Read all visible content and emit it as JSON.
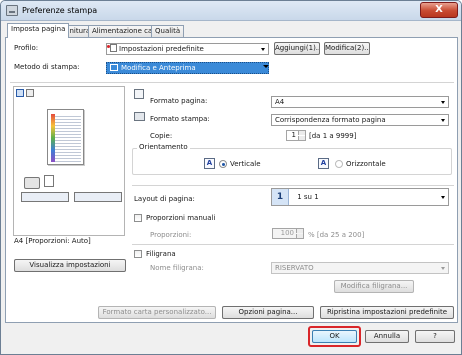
{
  "window": {
    "title": "Preferenze stampa",
    "close_label": "X"
  },
  "tabs": [
    {
      "label": "Imposta pagina",
      "active": true
    },
    {
      "label": "Finitura",
      "active": false
    },
    {
      "label": "Alimentazione carta",
      "active": false
    },
    {
      "label": "Qualità",
      "active": false
    }
  ],
  "profile": {
    "label": "Profilo:",
    "value": "Impostazioni predefinite",
    "add_label": "Aggiungi(1)...",
    "edit_label": "Modifica(2)..."
  },
  "print_method": {
    "label": "Metodo di stampa:",
    "value": "Modifica e Anteprima"
  },
  "preview": {
    "caption": "A4 [Proporzioni: Auto]",
    "show_settings_label": "Visualizza impostazioni"
  },
  "page_size": {
    "label": "Formato pagina:",
    "value": "A4"
  },
  "output_size": {
    "label": "Formato stampa:",
    "value": "Corrispondenza formato pagina"
  },
  "copies": {
    "label": "Copie:",
    "value": "1",
    "range": "[da 1 a 9999]"
  },
  "orientation": {
    "group_label": "Orientamento",
    "portrait_label": "Verticale",
    "landscape_label": "Orizzontale",
    "portrait_glyph": "A",
    "landscape_glyph": "A",
    "selected": "portrait"
  },
  "layout": {
    "label": "Layout di pagina:",
    "icon_number": "1",
    "value": "1 su 1"
  },
  "manual_scaling": {
    "checkbox_label": "Proporzioni manuali",
    "field_label": "Proporzioni:",
    "value": "100",
    "range": "% [da 25 a 200]"
  },
  "watermark": {
    "checkbox_label": "Filigrana",
    "name_label": "Nome filigrana:",
    "value": "RISERVATO",
    "edit_label": "Modifica filigrana..."
  },
  "bottom_buttons": {
    "custom_paper": "Formato carta personalizzato...",
    "page_options": "Opzioni pagina...",
    "restore_defaults": "Ripristina impostazioni predefinite"
  },
  "dialog_buttons": {
    "ok": "OK",
    "cancel": "Annulla",
    "help": "?"
  },
  "colors": {
    "accent": "#3b8ad8",
    "ok_highlight": "#d9262a",
    "close_red": "#c84a32"
  }
}
